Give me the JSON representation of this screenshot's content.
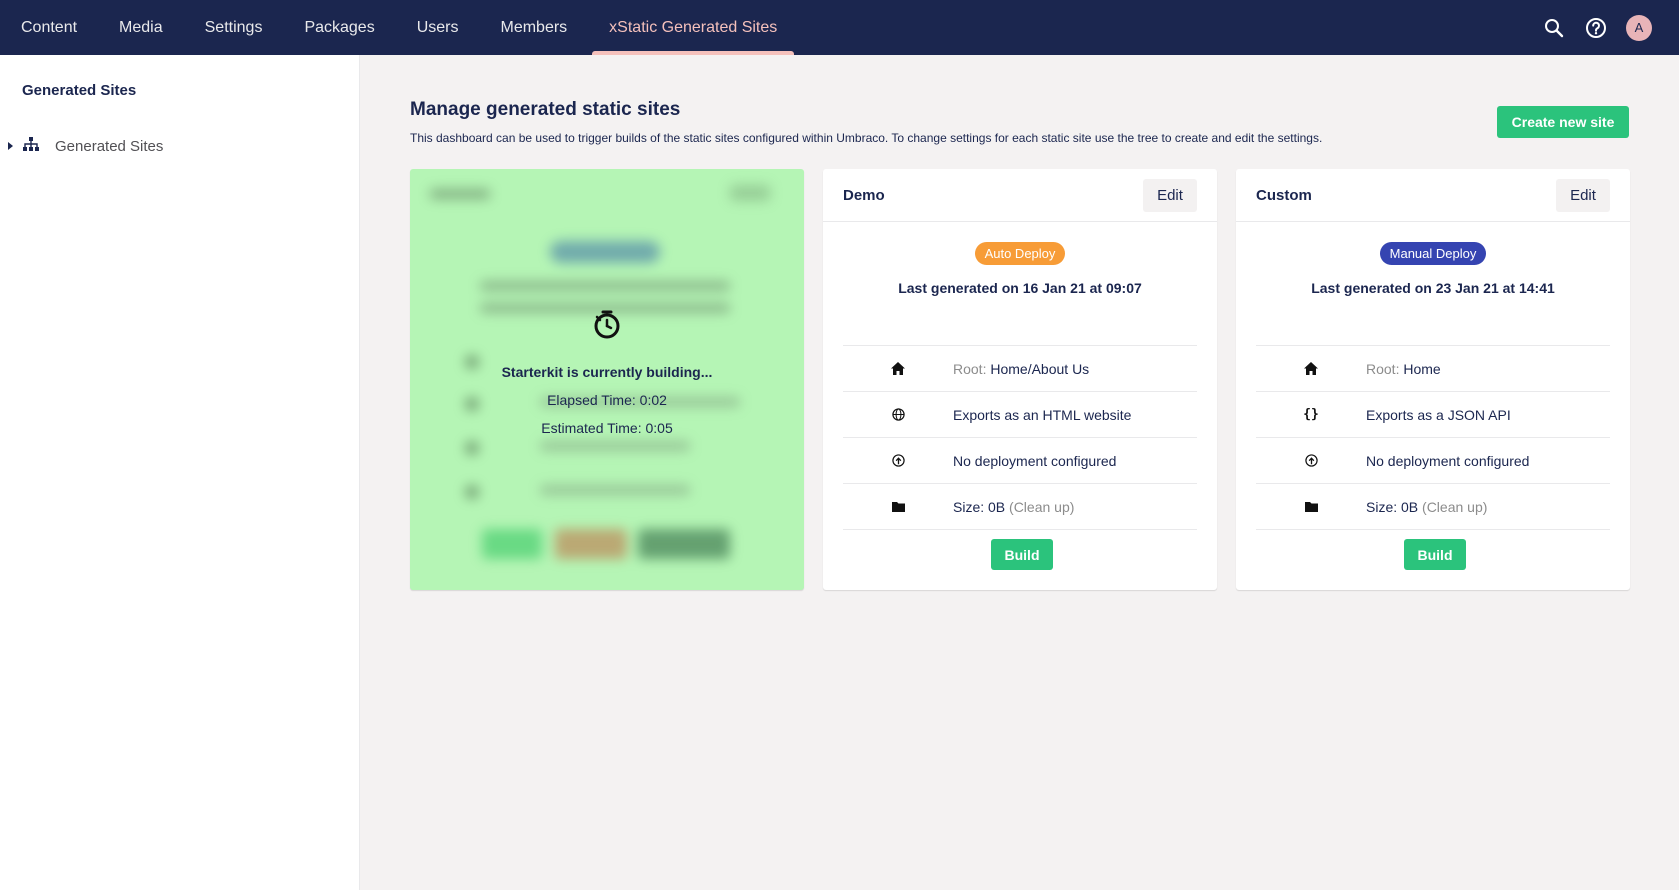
{
  "nav": {
    "items": [
      "Content",
      "Media",
      "Settings",
      "Packages",
      "Users",
      "Members",
      "xStatic Generated Sites"
    ],
    "active_index": 6,
    "avatar_initial": "A"
  },
  "sidebar": {
    "title": "Generated Sites",
    "tree_item": "Generated Sites"
  },
  "main": {
    "title": "Manage generated static sites",
    "description": "This dashboard can be used to trigger builds of the static sites configured within Umbraco. To change settings for each static site use the tree to create and edit the settings.",
    "create_label": "Create new site"
  },
  "building": {
    "status": "Starterkit is currently building...",
    "elapsed": "Elapsed Time: 0:02",
    "estimated": "Estimated Time: 0:05"
  },
  "cards": [
    {
      "name": "Demo",
      "edit_label": "Edit",
      "badge": "Auto Deploy",
      "badge_color": "#f79c37",
      "generated": "Last generated on 16 Jan 21 at 09:07",
      "root_label": "Root:",
      "root_value": "Home/About Us",
      "export": "Exports as an HTML website",
      "export_icon": "globe-icon",
      "deploy": "No deployment configured",
      "size": "Size: 0B",
      "cleanup": "(Clean up)",
      "build_label": "Build"
    },
    {
      "name": "Custom",
      "edit_label": "Edit",
      "badge": "Manual Deploy",
      "badge_color": "#3544b1",
      "generated": "Last generated on 23 Jan 21 at 14:41",
      "root_label": "Root:",
      "root_value": "Home",
      "export": "Exports as a JSON API",
      "export_icon": "braces-icon",
      "deploy": "No deployment configured",
      "size": "Size: 0B",
      "cleanup": "(Clean up)",
      "build_label": "Build"
    }
  ],
  "colors": {
    "topbar": "#1b264f",
    "active_nav": "#f5c1bc",
    "success": "#2bc37c",
    "building_bg": "#b5f5b5"
  }
}
